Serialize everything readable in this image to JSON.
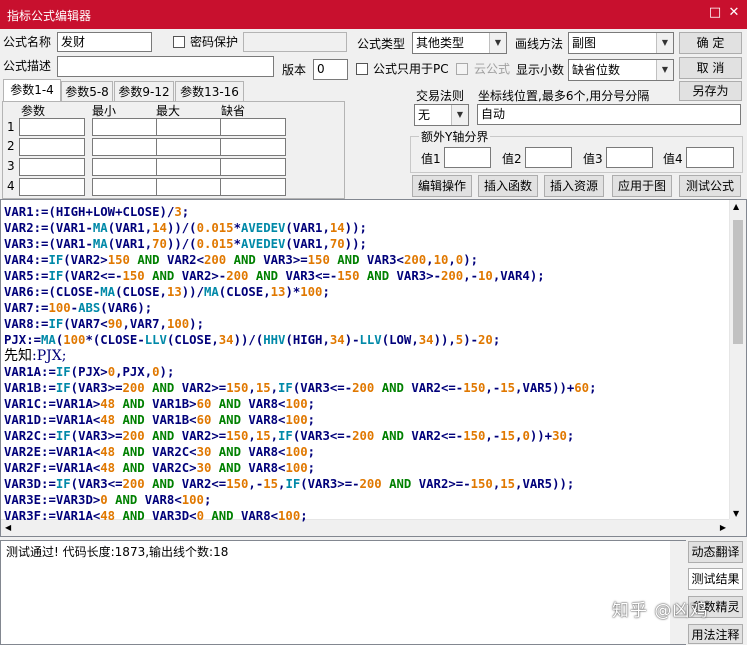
{
  "window": {
    "title": "指标公式编辑器",
    "minimize_glyph": "□",
    "close_glyph": "✕"
  },
  "formula": {
    "name_label": "公式名称",
    "name_value": "发财",
    "password_label": "密码保护",
    "type_label": "公式类型",
    "type_value": "其他类型",
    "draw_label": "画线方法",
    "draw_value": "副图",
    "desc_label": "公式描述",
    "desc_value": "",
    "version_label": "版本",
    "version_value": "0",
    "pc_only_label": "公式只用于PC",
    "cloud_label": "云公式",
    "decimals_label": "显示小数",
    "decimals_value": "缺省位数"
  },
  "buttons": {
    "ok": "确  定",
    "cancel": "取  消",
    "save_as": "另存为"
  },
  "trade_rule": {
    "label": "交易法则",
    "value": "无"
  },
  "coord": {
    "label": "坐标线位置,最多6个,用分号分隔",
    "value": "自动"
  },
  "yaxis": {
    "label": "额外Y轴分界",
    "v1": "值1",
    "v2": "值2",
    "v3": "值3",
    "v4": "值4"
  },
  "tabs": [
    "参数1-4",
    "参数5-8",
    "参数9-12",
    "参数13-16"
  ],
  "params": {
    "headers": [
      "参数",
      "最小",
      "最大",
      "缺省"
    ],
    "rows": [
      "1",
      "2",
      "3",
      "4"
    ]
  },
  "actions": [
    "编辑操作",
    "插入函数",
    "插入资源",
    "应用于图",
    "测试公式"
  ],
  "output": {
    "text": "测试通过! 代码长度:1873,输出线个数:18"
  },
  "side": [
    "动态翻译",
    "测试结果",
    "参数精灵",
    "用法注释"
  ],
  "watermark": "知乎 @凶鸡",
  "colors": {
    "title_bar": "#c8102e",
    "identifier": "#00007a",
    "number": "#e07800",
    "keyword": "#008000",
    "function": "#0089a8"
  },
  "code": [
    "VAR1:=(HIGH+LOW+CLOSE)/3;",
    "VAR2:=(VAR1-MA(VAR1,14))/(0.015*AVEDEV(VAR1,14));",
    "VAR3:=(VAR1-MA(VAR1,70))/(0.015*AVEDEV(VAR1,70));",
    "VAR4:=IF(VAR2>150 AND VAR2<200 AND VAR3>=150 AND VAR3<200,10,0);",
    "VAR5:=IF(VAR2<=-150 AND VAR2>-200 AND VAR3<=-150 AND VAR3>-200,-10,VAR4);",
    "VAR6:=(CLOSE-MA(CLOSE,13))/MA(CLOSE,13)*100;",
    "VAR7:=100-ABS(VAR6);",
    "VAR8:=IF(VAR7<90,VAR7,100);",
    "PJX:=MA(100*(CLOSE-LLV(CLOSE,34))/(HHV(HIGH,34)-LLV(LOW,34)),5)-20;",
    "先知:PJX;",
    "VAR1A:=IF(PJX>0,PJX,0);",
    "VAR1B:=IF(VAR3>=200 AND VAR2>=150,15,IF(VAR3<=-200 AND VAR2<=-150,-15,VAR5))+60;",
    "VAR1C:=VAR1A>48 AND VAR1B>60 AND VAR8<100;",
    "VAR1D:=VAR1A<48 AND VAR1B<60 AND VAR8<100;",
    "VAR2C:=IF(VAR3>=200 AND VAR2>=150,15,IF(VAR3<=-200 AND VAR2<=-150,-15,0))+30;",
    "VAR2E:=VAR1A<48 AND VAR2C<30 AND VAR8<100;",
    "VAR2F:=VAR1A<48 AND VAR2C>30 AND VAR8<100;",
    "VAR3D:=IF(VAR3<=200 AND VAR2<=150,-15,IF(VAR3>=-200 AND VAR2>=-150,15,VAR5));",
    "VAR3E:=VAR3D>0 AND VAR8<100;",
    "VAR3F:=VAR1A<48 AND VAR3D<0 AND VAR8<100;"
  ]
}
